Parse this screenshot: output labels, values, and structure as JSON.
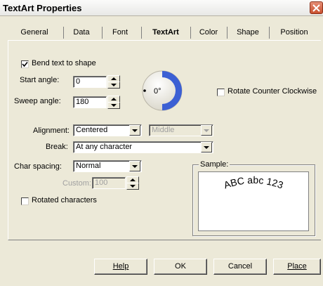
{
  "window": {
    "title": "TextArt Properties"
  },
  "tabs": [
    "General",
    "Data",
    "Font",
    "TextArt",
    "Color",
    "Shape",
    "Position"
  ],
  "active_tab": "TextArt",
  "bend": {
    "label": "Bend text to shape",
    "checked": true
  },
  "start_angle": {
    "label": "Start angle:",
    "value": "0"
  },
  "sweep_angle": {
    "label": "Sweep angle:",
    "value": "180"
  },
  "dial": {
    "label": "0°"
  },
  "rotate_ccw": {
    "label": "Rotate Counter Clockwise",
    "checked": false
  },
  "alignment": {
    "label": "Alignment:",
    "value": "Centered",
    "vertical_value": "Middle"
  },
  "break_opt": {
    "label": "Break:",
    "value": "At any character"
  },
  "char_spacing": {
    "label": "Char spacing:",
    "value": "Normal"
  },
  "custom": {
    "label": "Custom:",
    "value": "100"
  },
  "rotated_chars": {
    "label": "Rotated characters",
    "checked": false
  },
  "sample": {
    "label": "Sample:",
    "text": "ABC abc 123"
  },
  "buttons": {
    "help": "Help",
    "ok": "OK",
    "cancel": "Cancel",
    "place": "Place"
  },
  "colors": {
    "dialog_bg": "#ece9d8",
    "dial_arc": "#3b5fd4",
    "close_button": "#c9502f"
  }
}
